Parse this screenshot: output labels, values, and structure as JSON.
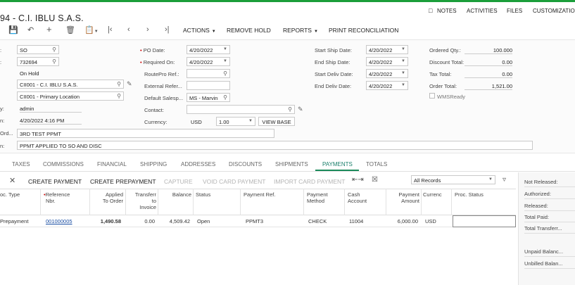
{
  "header": {
    "title": "94 - C.I. IBLU S.A.S.",
    "links": {
      "notes": "NOTES",
      "activities": "ACTIVITIES",
      "files": "FILES",
      "customization": "CUSTOMIZATION"
    }
  },
  "toolbar": {
    "actions": "ACTIONS",
    "remove_hold": "REMOVE HOLD",
    "reports": "REPORTS",
    "print_reconciliation": "PRINT RECONCILIATION"
  },
  "form": {
    "order_type": "SO",
    "order_nbr": "732694",
    "status": "On Hold",
    "customer": "CII001 - C.I. IBLU S.A.S.",
    "location": "CII001 - Primary Location",
    "owner_label": "y:",
    "owner": "admin",
    "date_label": "n:",
    "datetime": "4/20/2022 4:16 PM",
    "customer_ord_label": "Ord...",
    "customer_ord": "3RD TEST PPMT",
    "description_label": "n:",
    "description": "PPMT APPLIED TO SO AND DISC",
    "po_date_label": "PO Date:",
    "po_date": "4/20/2022",
    "required_on_label": "Required On:",
    "required_on": "4/20/2022",
    "routepro_label": "RoutePro Ref.:",
    "external_ref_label": "External Refer...",
    "default_salesp_label": "Default Salesp...",
    "default_salesp": "MS - Marvin",
    "contact_label": "Contact:",
    "currency_label": "Currency:",
    "currency": "USD",
    "rate": "1.00",
    "view_base": "VIEW BASE",
    "start_ship_label": "Start Ship Date:",
    "start_ship": "4/20/2022",
    "end_ship_label": "End Ship Date:",
    "end_ship": "4/20/2022",
    "start_deliv_label": "Start Deliv Date:",
    "start_deliv": "4/20/2022",
    "end_deliv_label": "End Deliv Date:",
    "end_deliv": "4/20/2022",
    "ordered_qty_label": "Ordered Qty.:",
    "ordered_qty": "100.000",
    "discount_total_label": "Discount Total:",
    "discount_total": "0.00",
    "tax_total_label": "Tax Total:",
    "tax_total": "0.00",
    "order_total_label": "Order Total:",
    "order_total": "1,521.00",
    "wmsready_label": "WMSReady"
  },
  "tabs": [
    "TAXES",
    "COMMISSIONS",
    "FINANCIAL",
    "SHIPPING",
    "ADDRESSES",
    "DISCOUNTS",
    "SHIPMENTS",
    "PAYMENTS",
    "TOTALS"
  ],
  "grid_toolbar": {
    "create_payment": "CREATE PAYMENT",
    "create_prepayment": "CREATE PREPAYMENT",
    "capture": "CAPTURE",
    "void_card_payment": "VOID CARD PAYMENT",
    "import_card_payment": "IMPORT CARD PAYMENT",
    "filter_value": "All Records"
  },
  "grid": {
    "headers": {
      "doc_type": "oc. Type",
      "reference_nbr_1": "Reference",
      "reference_nbr_2": "Nbr.",
      "applied_1": "Applied",
      "applied_2": "To Order",
      "transferred_1": "Transferr",
      "transferred_2": "to",
      "transferred_3": "Invoice",
      "balance": "Balance",
      "status": "Status",
      "payment_ref": "Payment Ref.",
      "payment_method_1": "Payment",
      "payment_method_2": "Method",
      "cash_account_1": "Cash",
      "cash_account_2": "Account",
      "payment_amount_1": "Payment",
      "payment_amount_2": "Amount",
      "currency": "Currenc",
      "proc_status": "Proc. Status"
    },
    "rows": [
      {
        "doc_type": "Prepayment",
        "reference_nbr": "001000005",
        "applied": "1,490.58",
        "transferred": "0.00",
        "balance": "4,509.42",
        "status": "Open",
        "payment_ref": "PPMT3",
        "payment_method": "CHECK",
        "cash_account": "11004",
        "payment_amount": "6,000.00",
        "currency": "USD",
        "proc_status": ""
      }
    ]
  },
  "summary": {
    "not_released": "Not Released:",
    "authorized": "Authorized:",
    "released": "Released:",
    "total_paid": "Total Paid:",
    "total_transferred": "Total Transferr...",
    "unpaid_balance": "Unpaid Balanc...",
    "unbilled_balance": "Unbilled Balan..."
  },
  "colors": {
    "accent": "#1a8a5a",
    "link": "#1a4ea3",
    "topbar": "#1b9e3a"
  }
}
